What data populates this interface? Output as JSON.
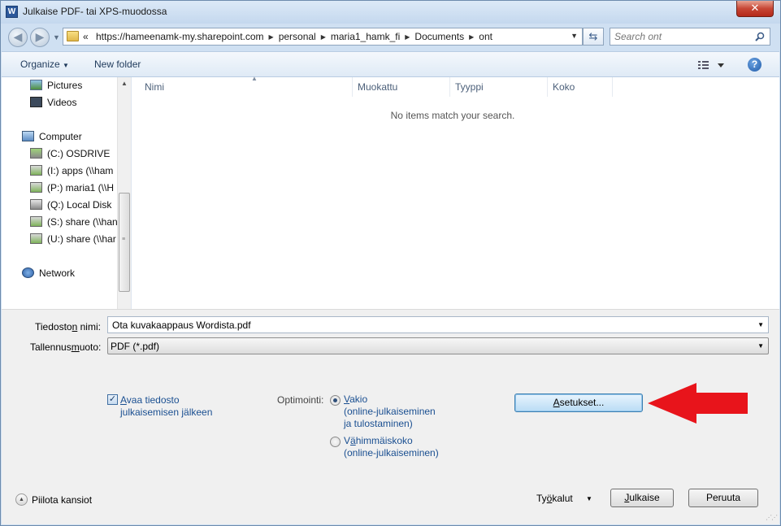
{
  "window": {
    "title": "Julkaise PDF- tai XPS-muodossa",
    "app_icon_letter": "W",
    "close_glyph": "✕"
  },
  "address": {
    "prefix": "«",
    "crumbs": [
      "https://hameenamk-my.sharepoint.com",
      "personal",
      "maria1_hamk_fi",
      "Documents",
      "ont"
    ]
  },
  "search": {
    "placeholder": "Search ont"
  },
  "toolbar": {
    "organize": "Organize",
    "new_folder": "New folder",
    "help": "?"
  },
  "nav_pane": {
    "items": [
      {
        "label": "Pictures",
        "icon": "pictures-icon"
      },
      {
        "label": "Videos",
        "icon": "videos-icon"
      },
      {
        "label": "Computer",
        "icon": "computer-icon"
      },
      {
        "label": "(C:) OSDRIVE",
        "icon": "drive-icon"
      },
      {
        "label": "(I:) apps (\\\\ham",
        "icon": "network-drive-icon"
      },
      {
        "label": "(P:) maria1 (\\\\H",
        "icon": "network-drive-icon"
      },
      {
        "label": "(Q:) Local Disk",
        "icon": "drive-icon"
      },
      {
        "label": "(S:) share (\\\\han",
        "icon": "network-drive-icon"
      },
      {
        "label": "(U:) share (\\\\har",
        "icon": "network-drive-icon"
      },
      {
        "label": "Network",
        "icon": "network-icon"
      }
    ]
  },
  "file_list": {
    "columns": [
      "Nimi",
      "Muokattu",
      "Tyyppi",
      "Koko"
    ],
    "empty_message": "No items match your search."
  },
  "form": {
    "filename_label": "Tiedoston nimi:",
    "filename_value": "Ota kuvakaappaus Wordista.pdf",
    "filetype_label": "Tallennusmuoto:",
    "filetype_value": "PDF (*.pdf)",
    "open_after_line1": "Avaa tiedosto",
    "open_after_line2": "julkaisemisen jälkeen",
    "open_after_checked": true,
    "optimize_label": "Optimointi:",
    "opt_standard_line1": "Vakio",
    "opt_standard_line2": "(online-julkaiseminen",
    "opt_standard_line3": "ja tulostaminen)",
    "opt_min_line1": "Vähimmäiskoko",
    "opt_min_line2": "(online-julkaiseminen)",
    "settings_button": "Asetukset...",
    "tools_label": "Työkalut",
    "publish_button": "Julkaise",
    "cancel_button": "Peruuta",
    "hide_folders": "Piilota kansiot"
  },
  "colors": {
    "annotation_arrow": "#e8141b",
    "accent": "#1a4f91"
  }
}
